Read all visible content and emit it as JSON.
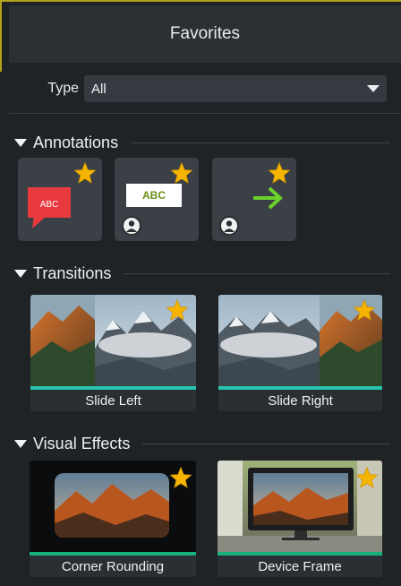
{
  "panel": {
    "title": "Favorites"
  },
  "filter": {
    "label": "Type",
    "value": "All"
  },
  "sections": {
    "annotations": {
      "title": "Annotations",
      "items": [
        {
          "name": "Callout bubble",
          "bubble_text": "ABC",
          "favorite": true
        },
        {
          "name": "Text box",
          "text": "ABC",
          "favorite": true
        },
        {
          "name": "Arrow",
          "favorite": true
        }
      ]
    },
    "transitions": {
      "title": "Transitions",
      "items": [
        {
          "label": "Slide Left",
          "favorite": true
        },
        {
          "label": "Slide Right",
          "favorite": true
        }
      ]
    },
    "visual_effects": {
      "title": "Visual Effects",
      "items": [
        {
          "label": "Corner Rounding",
          "favorite": true
        },
        {
          "label": "Device Frame",
          "favorite": true
        }
      ]
    }
  },
  "colors": {
    "background": "#1f2326",
    "header": "#2b3034",
    "accent": "#b5a21a",
    "star": "#f4b400",
    "transition_bar": "#27c4b0",
    "effect_bar": "#18b07a",
    "arrow_green": "#6bd12b",
    "callout_red": "#e8393f"
  }
}
